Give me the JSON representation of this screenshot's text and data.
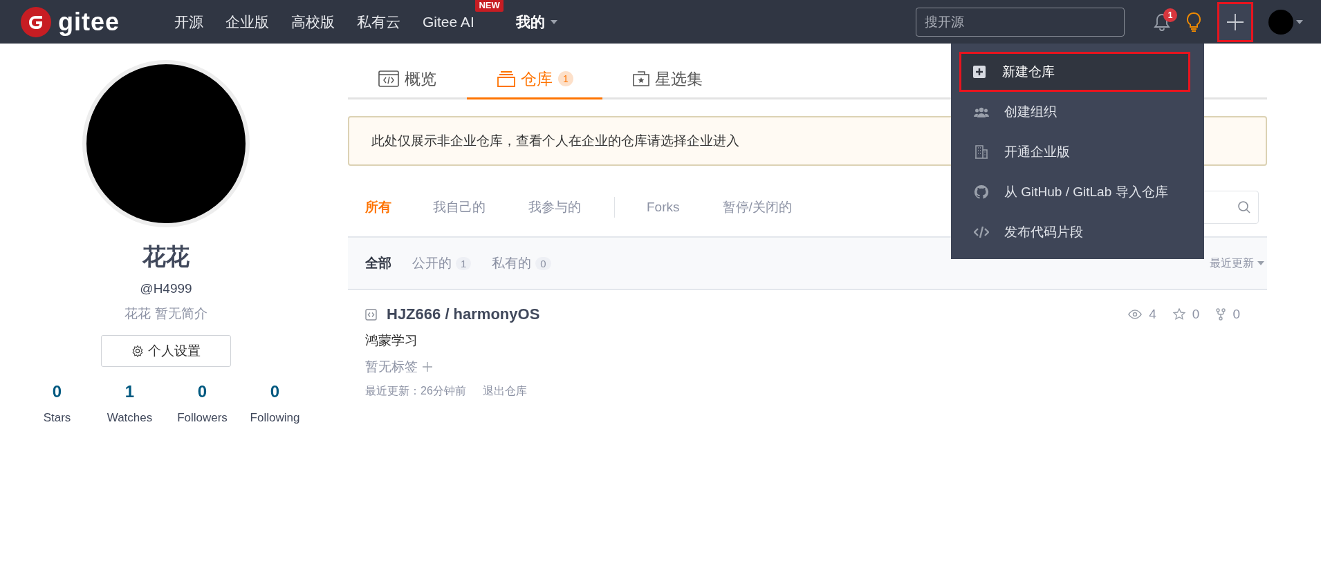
{
  "navbar": {
    "logo": "gitee",
    "links": [
      {
        "label": "开源"
      },
      {
        "label": "企业版"
      },
      {
        "label": "高校版"
      },
      {
        "label": "私有云"
      },
      {
        "label": "Gitee AI",
        "badge": "NEW"
      }
    ],
    "mine": "我的",
    "search": {
      "placeholder": "搜开源"
    },
    "notification_count": "1",
    "plus_highlighted": true
  },
  "menu": {
    "items": [
      {
        "label": "新建仓库",
        "kind": "new-repo",
        "selected": true,
        "highlighted": true
      },
      {
        "label": "创建组织",
        "kind": "organization",
        "selected": false,
        "highlighted": false
      },
      {
        "label": "开通企业版",
        "kind": "enterprise",
        "selected": false,
        "highlighted": false
      },
      {
        "label": "从 GitHub / GitLab 导入仓库",
        "kind": "import",
        "selected": false,
        "highlighted": false
      },
      {
        "label": "发布代码片段",
        "kind": "snippet",
        "selected": false,
        "highlighted": false
      }
    ]
  },
  "profile": {
    "name": "花花",
    "handle": "@H4999",
    "bio": "花花 暂无简介",
    "settings_button": "个人设置",
    "stats": [
      {
        "value": "0",
        "label": "Stars"
      },
      {
        "value": "1",
        "label": "Watches"
      },
      {
        "value": "0",
        "label": "Followers"
      },
      {
        "value": "0",
        "label": "Following"
      }
    ]
  },
  "tabs": [
    {
      "label": "概览",
      "kind": "overview",
      "selected": false
    },
    {
      "label": "仓库",
      "kind": "repos",
      "count": "1",
      "selected": true
    },
    {
      "label": "星选集",
      "kind": "collections",
      "selected": false
    }
  ],
  "notice": "此处仅展示非企业仓库，查看个人在企业的仓库请选择企业进入",
  "filter_groups": [
    [
      {
        "label": "所有",
        "selected": true
      },
      {
        "label": "我自己的",
        "selected": false
      },
      {
        "label": "我参与的",
        "selected": false
      }
    ],
    [
      {
        "label": "Forks",
        "selected": false
      },
      {
        "label": "暂停/关闭的",
        "selected": false
      }
    ]
  ],
  "visibility": [
    {
      "label": "全部",
      "selected": true
    },
    {
      "label": "公开的",
      "count": "1",
      "selected": false
    },
    {
      "label": "私有的",
      "count": "0",
      "selected": false
    }
  ],
  "sort": "最近更新",
  "repos": [
    {
      "name": "HJZ666 / harmonyOS",
      "description": "鸿蒙学习",
      "tags_placeholder": "暂无标签",
      "watches": "4",
      "stars": "0",
      "forks": "0",
      "updated": "最近更新：26分钟前",
      "action": "退出仓库"
    }
  ]
}
